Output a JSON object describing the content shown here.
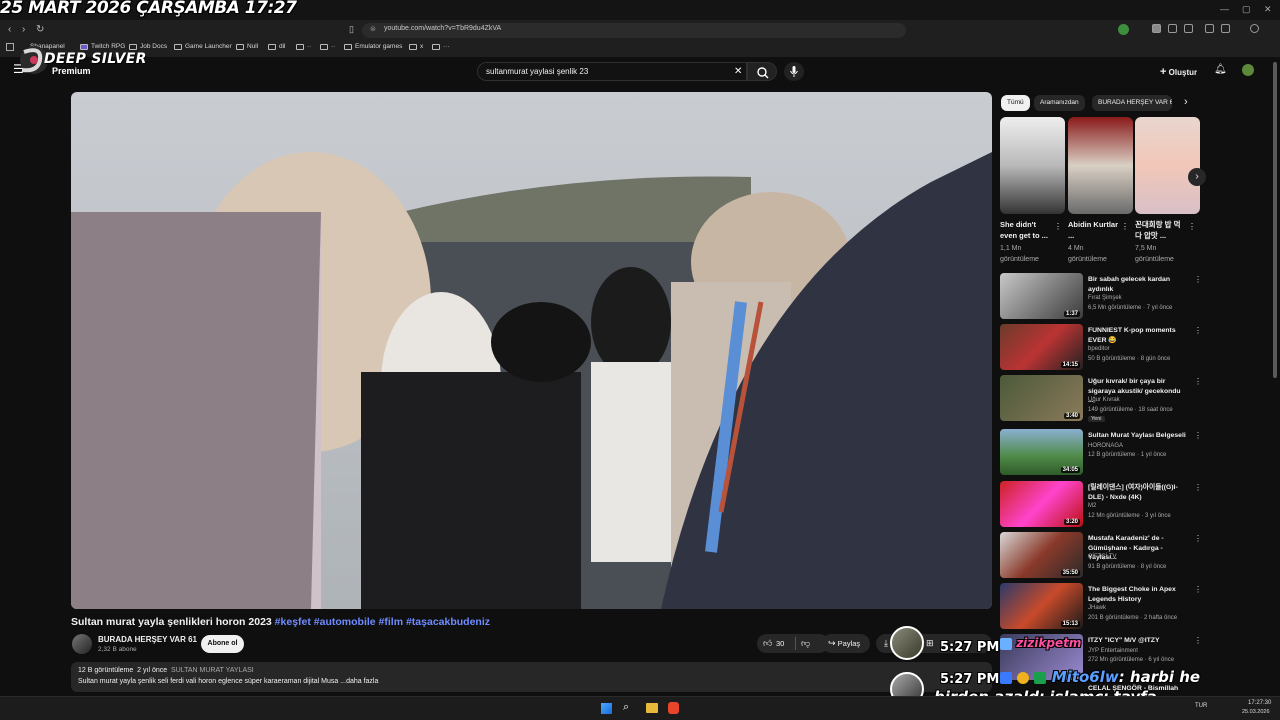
{
  "overlay_date": "25 MART 2026 ÇARŞAMBA 17:27",
  "browser": {
    "url": "youtube.com/watch?v=TbR9du4ZkVA",
    "bookmarks": [
      "Shanapanel",
      "Twitch RPG",
      "Job Docs",
      "Game Launcher",
      "Null",
      "dil",
      "··",
      "··",
      "Emulator games",
      "x",
      "···"
    ]
  },
  "yt": {
    "brand_overlay": "DEEP SILVER",
    "premium": "Premium",
    "search_value": "sultanmurat yaylasi şenlik 23",
    "create_label": "Oluştur"
  },
  "video": {
    "title": "Sultan murat yayla şenlikleri horon 2023",
    "hashtags": "#keşfet #automobile #film #taşacakbudeniz",
    "channel": "BURADA HERŞEY VAR 61",
    "subscribers": "2,32 B abone",
    "subscribe_label": "Abone ol",
    "likes": "30",
    "share_label": "Paylaş",
    "views": "12 B görüntüleme",
    "age": "2 yıl önce",
    "location_tag": "SULTAN MURAT YAYLASI",
    "description": "Sultan murat yayla şenlik seli ferdi vali horon eglence süper karaeraman dijital Musa ...daha fazla"
  },
  "sidebar": {
    "chips": [
      "Tümü",
      "Aramanızdan",
      "BURADA HERŞEY VAR 6"
    ],
    "shorts": [
      {
        "title": "She didn't even get to ...",
        "views": "1,1 Mn görüntüleme"
      },
      {
        "title": "Abidin Kurtlar ...",
        "views": "4 Mn görüntüleme"
      },
      {
        "title": "꼰대희랑 밥 먹다 압맛 ...",
        "views": "7,5 Mn görüntüleme"
      }
    ],
    "recommendations": [
      {
        "title": "Bir sabah gelecek kardan aydınlık",
        "channel": "Fırat Şimşek",
        "meta": "6,5 Mn görüntüleme · 7 yıl önce",
        "duration": "1:37"
      },
      {
        "title": "FUNNIEST K-pop moments EVER 😂",
        "channel": "bpeditor",
        "meta": "50 B görüntüleme · 8 gün önce",
        "duration": "14:15"
      },
      {
        "title": "Uğur kıvrak/ bir çaya bir sigaraya akustik/ gecekondu ...",
        "channel": "Uğur Kıvrak",
        "meta": "149 görüntüleme · 18 saat önce",
        "duration": "3:40",
        "badge": "Yeni"
      },
      {
        "title": "Sultan Murat Yaylası Belgeseli",
        "channel": "HORONAGA",
        "meta": "12 B görüntüleme · 1 yıl önce",
        "duration": "34:05"
      },
      {
        "title": "[릴레이댄스] (여자)아이들((G)I-DLE) - Nxde (4K)",
        "channel": "M2",
        "meta": "12 Mn görüntüleme · 3 yıl önce",
        "duration": "3:20"
      },
      {
        "title": "Mustafa Karadeniz' de - Gümüşhane - Kadırga - Yaylası...",
        "channel": "ÇİFTÇİ TV",
        "meta": "91 B görüntüleme · 8 yıl önce",
        "duration": "35:50"
      },
      {
        "title": "The Biggest Choke in Apex Legends History",
        "channel": "JHawk",
        "meta": "201 B görüntüleme · 2 hafta önce",
        "duration": "15:13"
      },
      {
        "title": "ITZY \"ICY\" M/V @ITZY",
        "channel": "JYP Entertainment",
        "meta": "272 Mn görüntüleme · 6 yıl önce",
        "duration": ""
      },
      {
        "title": "CELAL ŞENGÖR - Bismillah İlahi",
        "channel": "",
        "meta": "",
        "duration": ""
      }
    ]
  },
  "stream_overlay": {
    "clock1": "5:27 PM",
    "clock2": "5:27 PM",
    "chat_user1": "zizikpetm",
    "chat_user2": "Mito6lw",
    "chat_message": ": harbi he",
    "chat_line2": "birden azaldı islamcı tayfa"
  },
  "taskbar": {
    "lang": "TUR",
    "time": "17:27:30",
    "date": "25.03.2026"
  }
}
